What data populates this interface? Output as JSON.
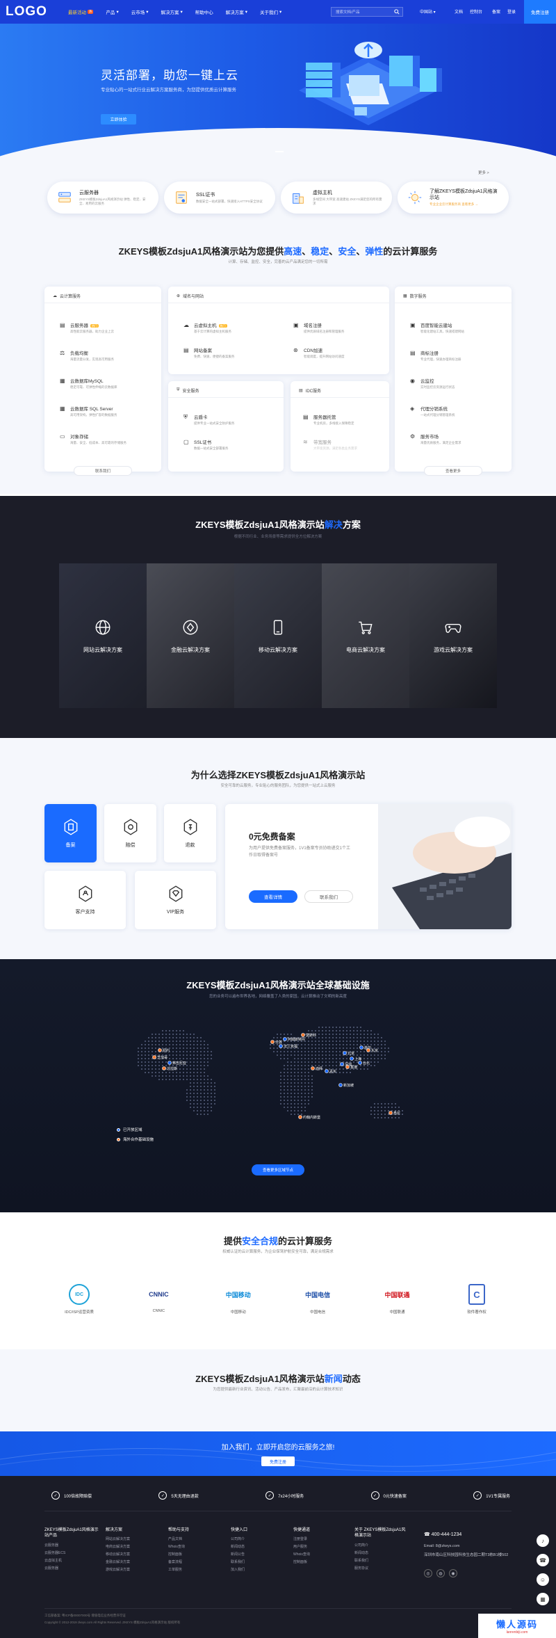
{
  "nav": {
    "logo": "LOGO",
    "items": [
      {
        "label": "最新活动",
        "badge": "热",
        "active": true
      },
      {
        "label": "产品"
      },
      {
        "label": "云市场"
      },
      {
        "label": "解决方案"
      },
      {
        "label": "帮助中心"
      },
      {
        "label": "解决方案"
      },
      {
        "label": "关于我们"
      }
    ],
    "search_placeholder": "搜索文档/产品",
    "lang": "中国站",
    "links": [
      "文档",
      "控制台",
      "备案",
      "登录"
    ],
    "register": "免费注册"
  },
  "hero": {
    "title": "灵活部署，助您一键上云",
    "subtitle": "专业贴心的一站式行业云解决方案服务商，为您提供优质云计算服务",
    "button": "立即体验"
  },
  "quick": {
    "more": "更多 >",
    "cards": [
      {
        "title": "云服务器",
        "desc": "ZKEYS模板ZdsjuA1风格演示站 弹性、稳定、安全、易用的云服务",
        "icon": "server-icon"
      },
      {
        "title": "SSL证书",
        "desc": "数据安全一站式部署，快速接入HTTPS安全协议",
        "icon": "certificate-icon"
      },
      {
        "title": "虚拟主机",
        "desc": "多线空间 大带宽 高速建站 ZKEYS满足您的所有需求",
        "icon": "building-icon"
      },
      {
        "title": "了解ZKEYS模板ZdsjuA1风格演示站",
        "desc": "专业企业云计算服务商 查看更多 →",
        "icon": "sun-icon"
      }
    ]
  },
  "services": {
    "title_parts": [
      "ZKEYS模板ZdsjuA1风格演示站为您提供",
      "高速",
      "、",
      "稳定",
      "、",
      "安全",
      "、",
      "弹性",
      "的云计算服务"
    ],
    "subtitle": "计算、存储、监控、安全，完善的云产品满足您的一切所需",
    "compute": {
      "header": "云计算服务",
      "items": [
        {
          "title": "云服务器",
          "tag": "热门",
          "desc": "高性能云服务器，助力企业上云"
        },
        {
          "title": "负载均衡",
          "desc": "海量流量分发，实现高可用服务"
        },
        {
          "title": "云数据库MySQL",
          "desc": "稳定可靠、可弹性伸缩的云数据库"
        },
        {
          "title": "云数据库 SQL Server",
          "desc": "高可用架构，弹性扩容的数据服务"
        },
        {
          "title": "对象存储",
          "desc": "海量、安全、低成本、高可靠的存储服务"
        }
      ],
      "button": "联系我们"
    },
    "domain": {
      "header": "域名与网站",
      "items": [
        {
          "title": "云虚拟主机",
          "tag": "热门",
          "desc": "基于云计算的虚拟主机服务"
        },
        {
          "title": "域名注册",
          "desc": "提供优质域名注册和管理服务"
        },
        {
          "title": "网站备案",
          "desc": "免费、快速、便捷的备案服务"
        },
        {
          "title": "CDN加速",
          "desc": "智能调度，提升网站访问速度"
        }
      ]
    },
    "security": {
      "header": "安全服务",
      "items": [
        {
          "title": "云盾卡",
          "desc": "提供专业一站式安全防护服务"
        },
        {
          "title": "SSL证书",
          "desc": "数据一站式安全部署服务"
        }
      ]
    },
    "idc": {
      "header": "IDC服务",
      "items": [
        {
          "title": "服务器托管",
          "desc": "专业机房，多线接入保障稳定"
        },
        {
          "title": "带宽服务",
          "desc": "大带宽资源，满足各类业务需求"
        }
      ]
    },
    "data": {
      "header": "数字服务",
      "items": [
        {
          "title": "百度智能云建站",
          "desc": "智能化建站工具，快速搭建网站"
        },
        {
          "title": "商标注册",
          "desc": "专业代理，快速办理商标注册"
        },
        {
          "title": "云监控",
          "desc": "实时监控云资源运行状态"
        },
        {
          "title": "代理分销系统",
          "desc": "一站式代理分销管理系统"
        },
        {
          "title": "服务市场",
          "desc": "海量优质服务，满足企业需求"
        }
      ],
      "button": "查看更多"
    }
  },
  "solutions": {
    "title_main": "ZKEYS模板ZdsjuA1风格演示站",
    "title_accent": "解决",
    "title_end": "方案",
    "subtitle": "根据不同行业、业务场景等需求提供全方位解决方案",
    "items": [
      {
        "label": "网站云解决方案",
        "icon": "globe-icon"
      },
      {
        "label": "金融云解决方案",
        "icon": "coin-icon"
      },
      {
        "label": "移动云解决方案",
        "icon": "phone-icon"
      },
      {
        "label": "电商云解决方案",
        "icon": "cart-icon"
      },
      {
        "label": "游戏云解决方案",
        "icon": "gamepad-icon"
      }
    ]
  },
  "why": {
    "title": "为什么选择ZKEYS模板ZdsjuA1风格演示站",
    "subtitle": "安全可靠的云服务，专业贴心的服务团队，为您提供一站式上云服务",
    "cards": [
      {
        "label": "备案",
        "icon": "record-icon",
        "active": true
      },
      {
        "label": "赔偿",
        "icon": "shield-coin-icon"
      },
      {
        "label": "退款",
        "icon": "refund-icon"
      },
      {
        "label": "客户支持",
        "icon": "support-icon"
      },
      {
        "label": "VIP服务",
        "icon": "diamond-icon"
      }
    ],
    "feature": {
      "title": "0元免费备案",
      "desc": "为用户提供免费备案服务，1V1备案专员协助递交1个工作日取得备案号",
      "primary": "查看详情",
      "secondary": "联系我们"
    }
  },
  "map": {
    "title": "ZKEYS模板ZdsjuA1风格演示站全球基础设施",
    "subtitle": "您的业务可以遍布世界各地，网络覆盖了人类的家园，云计算推动了文明的新高度",
    "legend": [
      "已开放区域",
      "海外合作基础设施"
    ],
    "labels": [
      "纽约",
      "芝加哥",
      "弗吉尼亚",
      "达拉斯",
      "伦敦",
      "法兰克福",
      "莫斯科",
      "阿姆斯特丹",
      "北京",
      "上海",
      "香港",
      "东京",
      "首尔",
      "新加坡",
      "悉尼",
      "迪拜",
      "孟买",
      "约翰内斯堡",
      "台北",
      "深圳"
    ],
    "button": "查看更多区域节点"
  },
  "compliance": {
    "title_start": "提供",
    "title_accent": "安全合规",
    "title_end": "的云计算服务",
    "subtitle": "权威认证的云计算服务，为企业保驾护航安全可靠，满足合规需求",
    "logos": [
      {
        "name": "IDC/ISP运营资质",
        "mark": "IDC",
        "color": "#1ea3d8"
      },
      {
        "name": "CNNIC",
        "mark": "CNNIC",
        "color": "#1f3b8c"
      },
      {
        "name": "中国移动",
        "mark": "中国移动",
        "color": "#0b8ad8"
      },
      {
        "name": "中国电信",
        "mark": "中国电信",
        "color": "#1e4fa8"
      },
      {
        "name": "中国联通",
        "mark": "中国联通",
        "color": "#d0131b"
      },
      {
        "name": "软件著作权",
        "mark": "C",
        "color": "#3b66c8"
      }
    ]
  },
  "news": {
    "title_start": "ZKEYS模板ZdsjuA1风格演示站",
    "title_accent": "新闻",
    "title_end": "动态",
    "subtitle": "为您提供最新行业资讯、活动公告、产品发布，汇聚最前沿的云计算技术知识"
  },
  "join": {
    "title": "加入我们，立即开启您的云服务之旅!",
    "button": "免费注册"
  },
  "footer": {
    "features": [
      {
        "label": "100倍故障赔偿",
        "icon": "medal-icon"
      },
      {
        "label": "5天无理由退款",
        "icon": "refund-icon"
      },
      {
        "label": "7x24小时服务",
        "icon": "clock-icon"
      },
      {
        "label": "0元快速备案",
        "icon": "record-icon"
      },
      {
        "label": "1V1专属服务",
        "icon": "user-icon"
      }
    ],
    "cols": [
      {
        "title": "ZKEYS模板ZdsjuA1风格演示站产品",
        "links": [
          "云服务器",
          "云服务器ECS",
          "云虚拟主机",
          "云服务器"
        ]
      },
      {
        "title": "解决方案",
        "links": [
          "网站云解决方案",
          "电商云解决方案",
          "移动云解决方案",
          "金融云解决方案",
          "游戏云解决方案"
        ]
      },
      {
        "title": "帮助与支持",
        "links": [
          "产品文档",
          "Whois查询",
          "控制面板",
          "备案流程",
          "工单服务"
        ]
      },
      {
        "title": "快捷入口",
        "links": [
          "公司简介",
          "新闻动态",
          "新闻公告",
          "联系我们",
          "加入我们"
        ]
      },
      {
        "title": "快捷通道",
        "links": [
          "注册登录",
          "用户服务",
          "Whois查询",
          "控制面板"
        ]
      },
      {
        "title": "关于 ZKEYS模板ZdsjuA1风格演示站",
        "links": [
          "公司简介",
          "新闻动态",
          "联系我们",
          "服务协议"
        ]
      }
    ],
    "phone": "400-444-1234",
    "email": "Email: 8@zkeys.com",
    "address": "深圳市南山区科技园科技生态园二期T3栋B1楼502",
    "copyright": "Copyright © 2012-2019 zkeys.com All Rights Reserved. ZKEYS 模板ZdsjuA1风格演示站 版权所有",
    "icp": "工信部备案: 粤ICP备00007000号  增值电信业务经营许可证",
    "badge": "懒人源码",
    "badge_url": "lanrenbiji.com"
  }
}
